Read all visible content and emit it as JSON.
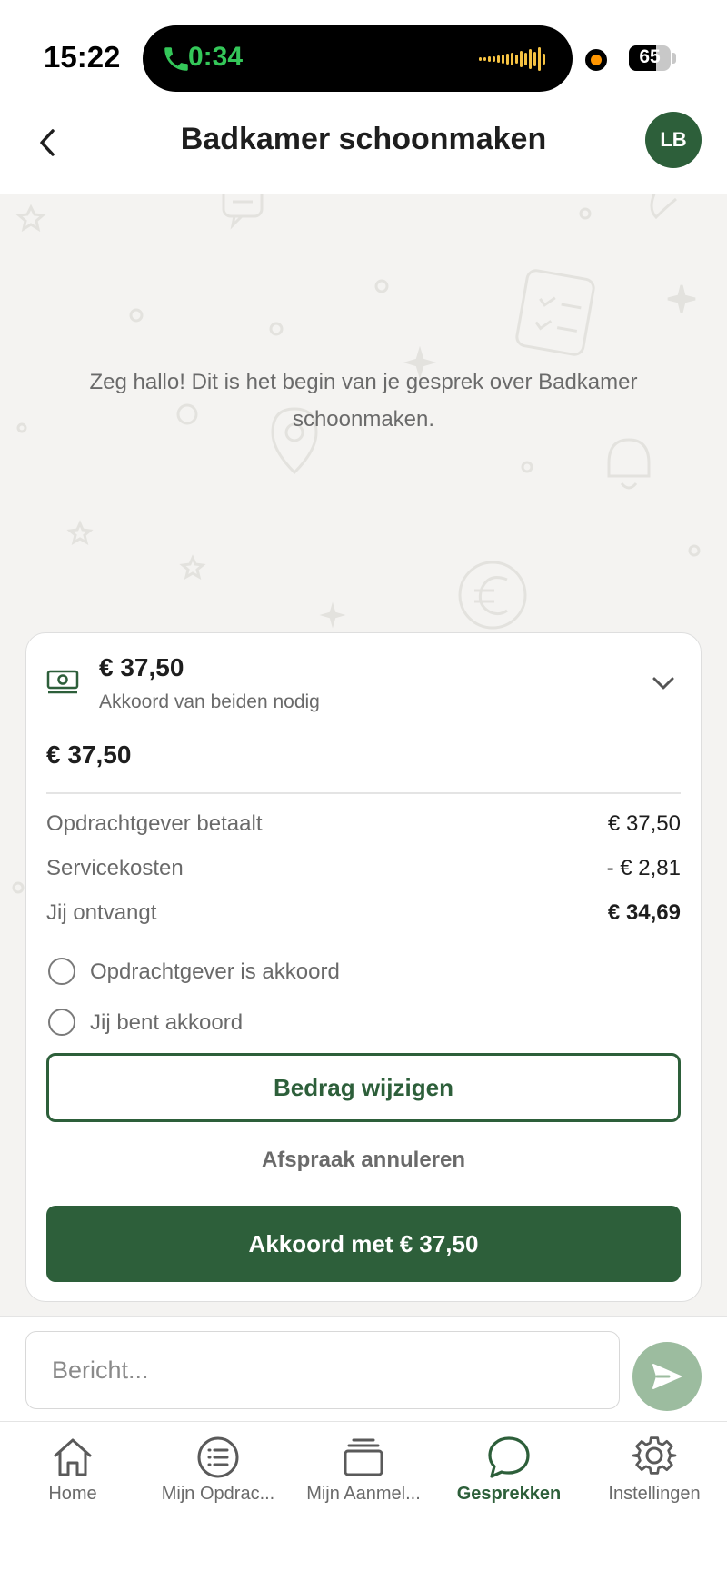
{
  "status_bar": {
    "time": "15:22",
    "call_duration": "0:34",
    "battery": "65",
    "battery_level": 0.65
  },
  "header": {
    "title": "Badkamer schoonmaken",
    "avatar_initials": "LB",
    "back_icon": "chevron-left-icon"
  },
  "chat": {
    "intro": "Zeg hallo! Dit is het begin van je gesprek over Badkamer schoonmaken."
  },
  "offer_card": {
    "icon": "money-icon",
    "amount": "€ 37,50",
    "subtitle": "Akkoord van beiden nodig",
    "total": "€ 37,50",
    "rows": [
      {
        "label": "Opdrachtgever betaalt",
        "value": "€ 37,50"
      },
      {
        "label": "Servicekosten",
        "value": "- € 2,81"
      },
      {
        "label": "Jij ontvangt",
        "value": "€ 34,69"
      }
    ],
    "approvals": [
      {
        "label": "Opdrachtgever is akkoord",
        "checked": false
      },
      {
        "label": "Jij bent akkoord",
        "checked": false
      }
    ],
    "change_button": "Bedrag wijzigen",
    "cancel_button": "Afspraak annuleren",
    "accept_button": "Akkoord met € 37,50"
  },
  "composer": {
    "placeholder": "Bericht...",
    "send_icon": "send-icon"
  },
  "tabbar": {
    "tabs": [
      {
        "label": "Home",
        "icon": "home-icon",
        "active": false
      },
      {
        "label": "Mijn Opdrac...",
        "icon": "list-icon",
        "active": false
      },
      {
        "label": "Mijn Aanmel...",
        "icon": "stack-icon",
        "active": false
      },
      {
        "label": "Gesprekken",
        "icon": "chat-icon",
        "active": true
      },
      {
        "label": "Instellingen",
        "icon": "gear-icon",
        "active": false
      }
    ]
  },
  "colors": {
    "primary": "#2d5f3a",
    "send_disabled": "#9cbc9f",
    "background": "#f4f3f1",
    "call_green": "#34c759"
  }
}
